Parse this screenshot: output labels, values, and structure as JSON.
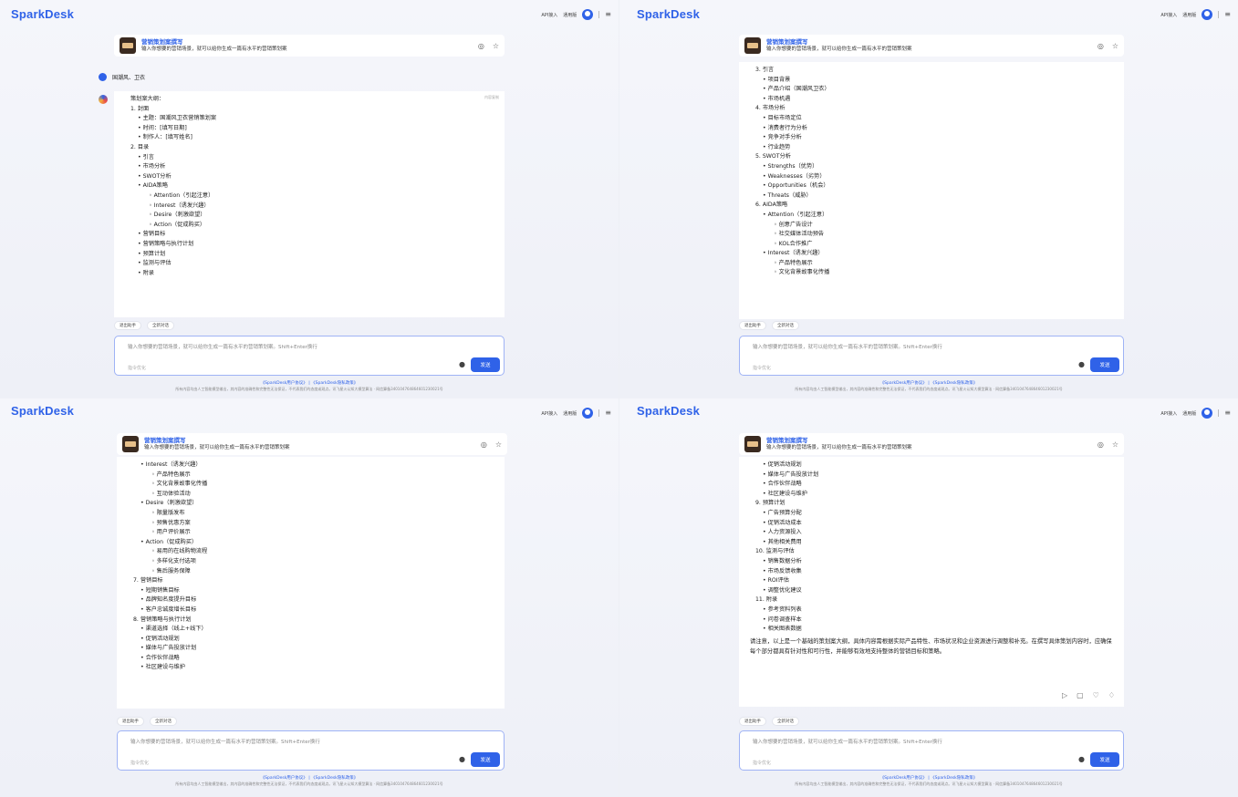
{
  "app": {
    "logo": "SparkDesk",
    "top_api": "API接入",
    "top_mode": "通用版",
    "menu_glyph": "≡"
  },
  "assistant": {
    "title": "营销策划案撰写",
    "subtitle": "输入你想要的营销场景，就可以给你生成一篇有水平的营销策划案",
    "pin_icon": "◎",
    "star_icon": "☆"
  },
  "user_msg": "国潮风、卫衣",
  "copy_label": "内容复制",
  "tools": {
    "exit": "退出助手",
    "new_chat": "全新对话"
  },
  "input": {
    "placeholder": "输入你想要的营销场景，就可以给你生成一篇有水平的营销策划案。Shift+Enter换行",
    "hint": "指令优化",
    "send": "发送"
  },
  "footer": {
    "links": "《SparkDesk用户协议》 | 《SparkDesk隐私政策》",
    "legal": "所有内容均由人工智能模型输出，其内容的准确性和完整性无法保证，不代表我们的态度或观点。讯飞星火认知大模型算法 · 网信算备340104764864601230021号"
  },
  "panel0": [
    {
      "c": "h",
      "t": "策划案大纲："
    },
    {
      "c": "h",
      "t": "1. 封面"
    },
    {
      "c": "b1",
      "t": "• 主题：国潮风卫衣营销策划案"
    },
    {
      "c": "b1",
      "t": "• 时间：[填写日期]"
    },
    {
      "c": "b1",
      "t": "• 制作人：[填写姓名]"
    },
    {
      "c": "h",
      "t": "2. 目录"
    },
    {
      "c": "b1",
      "t": "• 引言"
    },
    {
      "c": "b1",
      "t": "• 市场分析"
    },
    {
      "c": "b1",
      "t": "• SWOT分析"
    },
    {
      "c": "b1",
      "t": "• AIDA策略"
    },
    {
      "c": "b2",
      "t": "◦ Attention（引起注意）"
    },
    {
      "c": "b2",
      "t": "◦ Interest（诱发兴趣）"
    },
    {
      "c": "b2",
      "t": "◦ Desire（刺激欲望）"
    },
    {
      "c": "b2",
      "t": "◦ Action（促成购买）"
    },
    {
      "c": "b1",
      "t": "• 营销目标"
    },
    {
      "c": "b1",
      "t": "• 营销策略与执行计划"
    },
    {
      "c": "b1",
      "t": "• 预算计划"
    },
    {
      "c": "b1",
      "t": "• 监测与评估"
    },
    {
      "c": "b1",
      "t": "• 附录"
    }
  ],
  "panel1": [
    {
      "c": "h",
      "t": "3. 引言"
    },
    {
      "c": "b1",
      "t": "• 项目背景"
    },
    {
      "c": "b1",
      "t": "• 产品介绍（国潮风卫衣）"
    },
    {
      "c": "b1",
      "t": "• 市场机遇"
    },
    {
      "c": "h",
      "t": "4. 市场分析"
    },
    {
      "c": "b1",
      "t": "• 目标市场定位"
    },
    {
      "c": "b1",
      "t": "• 消费者行为分析"
    },
    {
      "c": "b1",
      "t": "• 竞争对手分析"
    },
    {
      "c": "b1",
      "t": "• 行业趋势"
    },
    {
      "c": "h",
      "t": "5. SWOT分析"
    },
    {
      "c": "b1",
      "t": "• Strengths（优势）"
    },
    {
      "c": "b1",
      "t": "• Weaknesses（劣势）"
    },
    {
      "c": "b1",
      "t": "• Opportunities（机会）"
    },
    {
      "c": "b1",
      "t": "• Threats（威胁）"
    },
    {
      "c": "h",
      "t": "6. AIDA策略"
    },
    {
      "c": "b1",
      "t": "• Attention（引起注意）"
    },
    {
      "c": "b2",
      "t": "◦ 创意广告设计"
    },
    {
      "c": "b2",
      "t": "◦ 社交媒体活动预告"
    },
    {
      "c": "b2",
      "t": "◦ KOL合作推广"
    },
    {
      "c": "b1",
      "t": "• Interest（诱发兴趣）"
    },
    {
      "c": "b2",
      "t": "◦ 产品特色展示"
    },
    {
      "c": "b2",
      "t": "◦ 文化背景故事化传播"
    }
  ],
  "panel2": [
    {
      "c": "b1",
      "t": "• Interest（诱发兴趣）"
    },
    {
      "c": "b2",
      "t": "◦ 产品特色展示"
    },
    {
      "c": "b2",
      "t": "◦ 文化背景故事化传播"
    },
    {
      "c": "b2",
      "t": "◦ 互动体验活动"
    },
    {
      "c": "b1",
      "t": "• Desire（刺激欲望）"
    },
    {
      "c": "b2",
      "t": "◦ 限量版发布"
    },
    {
      "c": "b2",
      "t": "◦ 预售优惠方案"
    },
    {
      "c": "b2",
      "t": "◦ 用户评价展示"
    },
    {
      "c": "b1",
      "t": "• Action（促成购买）"
    },
    {
      "c": "b2",
      "t": "◦ 易用的在线购物流程"
    },
    {
      "c": "b2",
      "t": "◦ 多样化支付选项"
    },
    {
      "c": "b2",
      "t": "◦ 售后服务保障"
    },
    {
      "c": "h",
      "t": "7. 营销目标"
    },
    {
      "c": "b1",
      "t": "• 短期销售目标"
    },
    {
      "c": "b1",
      "t": "• 品牌知名度提升目标"
    },
    {
      "c": "b1",
      "t": "• 客户忠诚度增长目标"
    },
    {
      "c": "h",
      "t": "8. 营销策略与执行计划"
    },
    {
      "c": "b1",
      "t": "• 渠道选择（线上+线下）"
    },
    {
      "c": "b1",
      "t": "• 促销活动规划"
    },
    {
      "c": "b1",
      "t": "• 媒体与广告投放计划"
    },
    {
      "c": "b1",
      "t": "• 合作伙伴战略"
    },
    {
      "c": "b1",
      "t": "• 社区建设与维护"
    }
  ],
  "panel3": [
    {
      "c": "b1",
      "t": "• 促销活动规划"
    },
    {
      "c": "b1",
      "t": "• 媒体与广告投放计划"
    },
    {
      "c": "b1",
      "t": "• 合作伙伴战略"
    },
    {
      "c": "b1",
      "t": "• 社区建设与维护"
    },
    {
      "c": "h",
      "t": "9. 预算计划"
    },
    {
      "c": "b1",
      "t": "• 广告预算分配"
    },
    {
      "c": "b1",
      "t": "• 促销活动成本"
    },
    {
      "c": "b1",
      "t": "• 人力资源投入"
    },
    {
      "c": "b1",
      "t": "• 其他相关费用"
    },
    {
      "c": "h",
      "t": "10. 监测与评估"
    },
    {
      "c": "b1",
      "t": "• 销售数据分析"
    },
    {
      "c": "b1",
      "t": "• 市场反馈收集"
    },
    {
      "c": "b1",
      "t": "• ROI评估"
    },
    {
      "c": "b1",
      "t": "• 调整优化建议"
    },
    {
      "c": "h",
      "t": "11. 附录"
    },
    {
      "c": "b1",
      "t": "• 参考资料列表"
    },
    {
      "c": "b1",
      "t": "• 问卷调查样本"
    },
    {
      "c": "b1",
      "t": "• 相关图表数据"
    }
  ],
  "closing_note": "请注意，以上是一个基础的策划案大纲，具体内容需根据实际产品特性、市场状况和企业资源进行调整和补充。在撰写具体策划内容时，应确保每个部分都具有针对性和可行性，并能够有效地支持整体的营销目标和策略。",
  "action_icons": [
    "play-icon",
    "copy-icon",
    "thumb-up-icon",
    "thumb-down-icon"
  ]
}
